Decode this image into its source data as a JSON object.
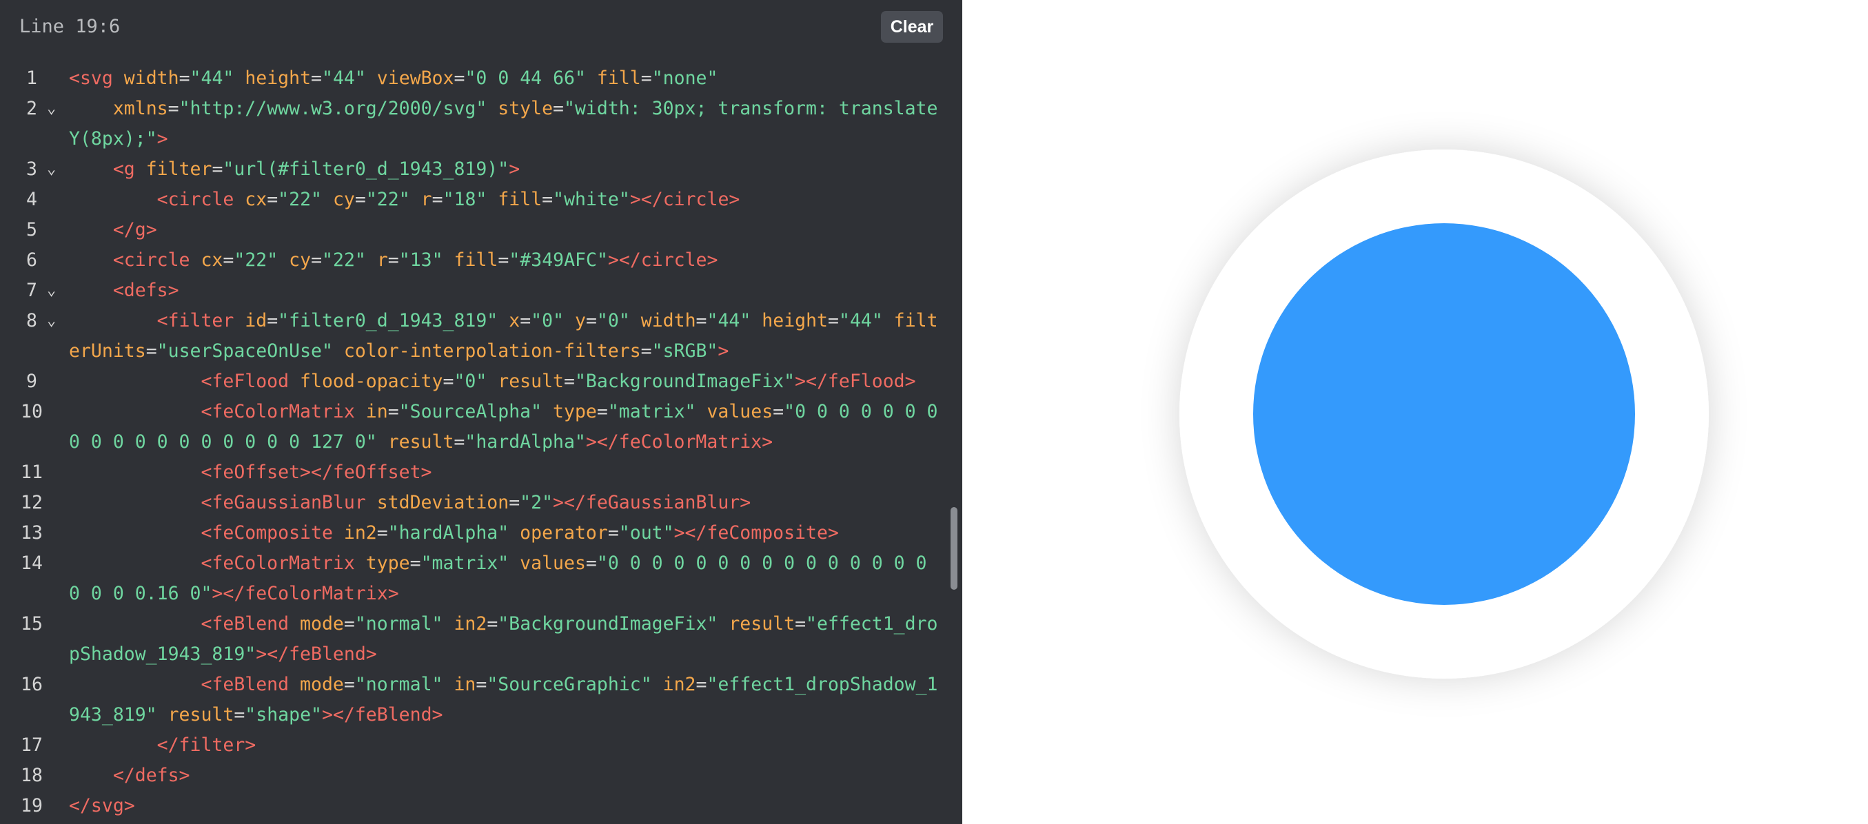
{
  "editor": {
    "status": "Line 19:6",
    "clear_label": "Clear",
    "lines": [
      {
        "n": "1",
        "fold": false,
        "tokens": [
          [
            "tag",
            "<svg "
          ],
          [
            "attr",
            "width"
          ],
          [
            "eq",
            "="
          ],
          [
            "str",
            "\"44\" "
          ],
          [
            "attr",
            "height"
          ],
          [
            "eq",
            "="
          ],
          [
            "str",
            "\"44\" "
          ],
          [
            "attr",
            "viewBox"
          ],
          [
            "eq",
            "="
          ],
          [
            "str",
            "\"0 0 44 66\" "
          ],
          [
            "attr",
            "fill"
          ],
          [
            "eq",
            "="
          ],
          [
            "str",
            "\"none\""
          ]
        ]
      },
      {
        "n": "2",
        "fold": true,
        "tokens": [
          [
            "txt",
            "    "
          ],
          [
            "attr",
            "xmlns"
          ],
          [
            "eq",
            "="
          ],
          [
            "str",
            "\"http://www.w3.org/2000/svg\" "
          ],
          [
            "attr",
            "style"
          ],
          [
            "eq",
            "="
          ],
          [
            "str",
            "\"width: 30px; transform: translateY(8px);\""
          ],
          [
            "tag",
            ">"
          ]
        ]
      },
      {
        "n": "3",
        "fold": true,
        "tokens": [
          [
            "txt",
            "    "
          ],
          [
            "tag",
            "<g "
          ],
          [
            "attr",
            "filter"
          ],
          [
            "eq",
            "="
          ],
          [
            "str",
            "\"url(#filter0_d_1943_819)\""
          ],
          [
            "tag",
            ">"
          ]
        ]
      },
      {
        "n": "4",
        "fold": false,
        "tokens": [
          [
            "txt",
            "        "
          ],
          [
            "tag",
            "<circle "
          ],
          [
            "attr",
            "cx"
          ],
          [
            "eq",
            "="
          ],
          [
            "str",
            "\"22\" "
          ],
          [
            "attr",
            "cy"
          ],
          [
            "eq",
            "="
          ],
          [
            "str",
            "\"22\" "
          ],
          [
            "attr",
            "r"
          ],
          [
            "eq",
            "="
          ],
          [
            "str",
            "\"18\" "
          ],
          [
            "attr",
            "fill"
          ],
          [
            "eq",
            "="
          ],
          [
            "str",
            "\"white\""
          ],
          [
            "tag",
            "></circle>"
          ]
        ]
      },
      {
        "n": "5",
        "fold": false,
        "tokens": [
          [
            "txt",
            "    "
          ],
          [
            "tag",
            "</g>"
          ]
        ]
      },
      {
        "n": "6",
        "fold": false,
        "tokens": [
          [
            "txt",
            "    "
          ],
          [
            "tag",
            "<circle "
          ],
          [
            "attr",
            "cx"
          ],
          [
            "eq",
            "="
          ],
          [
            "str",
            "\"22\" "
          ],
          [
            "attr",
            "cy"
          ],
          [
            "eq",
            "="
          ],
          [
            "str",
            "\"22\" "
          ],
          [
            "attr",
            "r"
          ],
          [
            "eq",
            "="
          ],
          [
            "str",
            "\"13\" "
          ],
          [
            "attr",
            "fill"
          ],
          [
            "eq",
            "="
          ],
          [
            "str",
            "\"#349AFC\""
          ],
          [
            "tag",
            "></circle>"
          ]
        ]
      },
      {
        "n": "7",
        "fold": true,
        "tokens": [
          [
            "txt",
            "    "
          ],
          [
            "tag",
            "<defs>"
          ]
        ]
      },
      {
        "n": "8",
        "fold": true,
        "tokens": [
          [
            "txt",
            "        "
          ],
          [
            "tag",
            "<filter "
          ],
          [
            "attr",
            "id"
          ],
          [
            "eq",
            "="
          ],
          [
            "str",
            "\"filter0_d_1943_819\" "
          ],
          [
            "attr",
            "x"
          ],
          [
            "eq",
            "="
          ],
          [
            "str",
            "\"0\" "
          ],
          [
            "attr",
            "y"
          ],
          [
            "eq",
            "="
          ],
          [
            "str",
            "\"0\" "
          ],
          [
            "attr",
            "width"
          ],
          [
            "eq",
            "="
          ],
          [
            "str",
            "\"44\" "
          ],
          [
            "attr",
            "height"
          ],
          [
            "eq",
            "="
          ],
          [
            "str",
            "\"44\" "
          ],
          [
            "attr",
            "filterUnits"
          ],
          [
            "eq",
            "="
          ],
          [
            "str",
            "\"userSpaceOnUse\" "
          ],
          [
            "attr",
            "color-interpolation-filters"
          ],
          [
            "eq",
            "="
          ],
          [
            "str",
            "\"sRGB\""
          ],
          [
            "tag",
            ">"
          ]
        ]
      },
      {
        "n": "9",
        "fold": false,
        "tokens": [
          [
            "txt",
            "            "
          ],
          [
            "tag",
            "<feFlood "
          ],
          [
            "attr",
            "flood-opacity"
          ],
          [
            "eq",
            "="
          ],
          [
            "str",
            "\"0\" "
          ],
          [
            "attr",
            "result"
          ],
          [
            "eq",
            "="
          ],
          [
            "str",
            "\"BackgroundImageFix\""
          ],
          [
            "tag",
            "></feFlood>"
          ]
        ]
      },
      {
        "n": "10",
        "fold": false,
        "tokens": [
          [
            "txt",
            "            "
          ],
          [
            "tag",
            "<feColorMatrix "
          ],
          [
            "attr",
            "in"
          ],
          [
            "eq",
            "="
          ],
          [
            "str",
            "\"SourceAlpha\" "
          ],
          [
            "attr",
            "type"
          ],
          [
            "eq",
            "="
          ],
          [
            "str",
            "\"matrix\" "
          ],
          [
            "attr",
            "values"
          ],
          [
            "eq",
            "="
          ],
          [
            "str",
            "\"0 0 0 0 0 0 0 0 0 0 0 0 0 0 0 0 0 0 127 0\" "
          ],
          [
            "attr",
            "result"
          ],
          [
            "eq",
            "="
          ],
          [
            "str",
            "\"hardAlpha\""
          ],
          [
            "tag",
            "></feColorMatrix>"
          ]
        ]
      },
      {
        "n": "11",
        "fold": false,
        "tokens": [
          [
            "txt",
            "            "
          ],
          [
            "tag",
            "<feOffset></feOffset>"
          ]
        ]
      },
      {
        "n": "12",
        "fold": false,
        "tokens": [
          [
            "txt",
            "            "
          ],
          [
            "tag",
            "<feGaussianBlur "
          ],
          [
            "attr",
            "stdDeviation"
          ],
          [
            "eq",
            "="
          ],
          [
            "str",
            "\"2\""
          ],
          [
            "tag",
            "></feGaussianBlur>"
          ]
        ]
      },
      {
        "n": "13",
        "fold": false,
        "tokens": [
          [
            "txt",
            "            "
          ],
          [
            "tag",
            "<feComposite "
          ],
          [
            "attr",
            "in2"
          ],
          [
            "eq",
            "="
          ],
          [
            "str",
            "\"hardAlpha\" "
          ],
          [
            "attr",
            "operator"
          ],
          [
            "eq",
            "="
          ],
          [
            "str",
            "\"out\""
          ],
          [
            "tag",
            "></feComposite>"
          ]
        ]
      },
      {
        "n": "14",
        "fold": false,
        "tokens": [
          [
            "txt",
            "            "
          ],
          [
            "tag",
            "<feColorMatrix "
          ],
          [
            "attr",
            "type"
          ],
          [
            "eq",
            "="
          ],
          [
            "str",
            "\"matrix\" "
          ],
          [
            "attr",
            "values"
          ],
          [
            "eq",
            "="
          ],
          [
            "str",
            "\"0 0 0 0 0 0 0 0 0 0 0 0 0 0 0 0 0 0 0.16 0\""
          ],
          [
            "tag",
            "></feColorMatrix>"
          ]
        ]
      },
      {
        "n": "15",
        "fold": false,
        "tokens": [
          [
            "txt",
            "            "
          ],
          [
            "tag",
            "<feBlend "
          ],
          [
            "attr",
            "mode"
          ],
          [
            "eq",
            "="
          ],
          [
            "str",
            "\"normal\" "
          ],
          [
            "attr",
            "in2"
          ],
          [
            "eq",
            "="
          ],
          [
            "str",
            "\"BackgroundImageFix\" "
          ],
          [
            "attr",
            "result"
          ],
          [
            "eq",
            "="
          ],
          [
            "str",
            "\"effect1_dropShadow_1943_819\""
          ],
          [
            "tag",
            "></feBlend>"
          ]
        ]
      },
      {
        "n": "16",
        "fold": false,
        "tokens": [
          [
            "txt",
            "            "
          ],
          [
            "tag",
            "<feBlend "
          ],
          [
            "attr",
            "mode"
          ],
          [
            "eq",
            "="
          ],
          [
            "str",
            "\"normal\" "
          ],
          [
            "attr",
            "in"
          ],
          [
            "eq",
            "="
          ],
          [
            "str",
            "\"SourceGraphic\" "
          ],
          [
            "attr",
            "in2"
          ],
          [
            "eq",
            "="
          ],
          [
            "str",
            "\"effect1_dropShadow_1943_819\" "
          ],
          [
            "attr",
            "result"
          ],
          [
            "eq",
            "="
          ],
          [
            "str",
            "\"shape\""
          ],
          [
            "tag",
            "></feBlend>"
          ]
        ]
      },
      {
        "n": "17",
        "fold": false,
        "tokens": [
          [
            "txt",
            "        "
          ],
          [
            "tag",
            "</filter>"
          ]
        ]
      },
      {
        "n": "18",
        "fold": false,
        "tokens": [
          [
            "txt",
            "    "
          ],
          [
            "tag",
            "</defs>"
          ]
        ]
      },
      {
        "n": "19",
        "fold": false,
        "tokens": [
          [
            "tag",
            "</svg>"
          ]
        ]
      }
    ]
  },
  "preview": {
    "outer_fill": "#ffffff",
    "inner_fill": "#349AFC"
  },
  "icons": {
    "fold": "chevron-down-icon"
  }
}
